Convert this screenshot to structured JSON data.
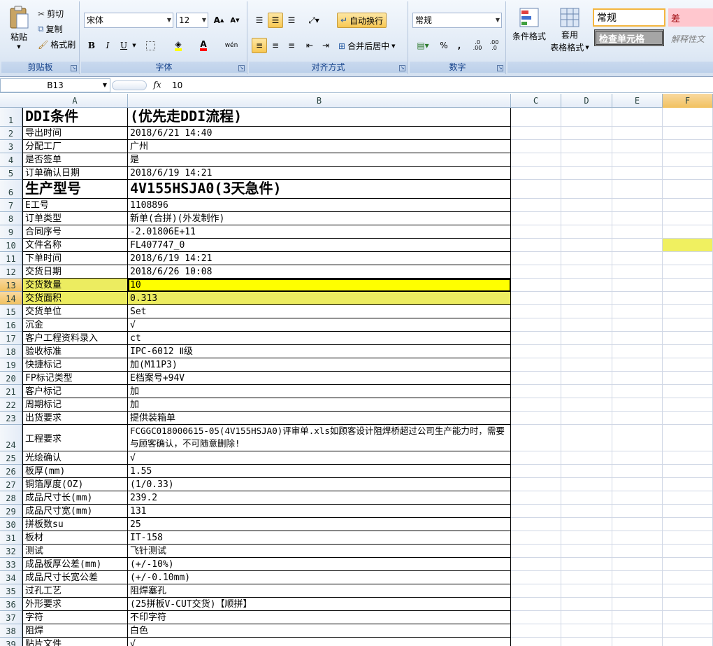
{
  "ribbon": {
    "clipboard": {
      "label": "剪贴板",
      "paste": "粘贴",
      "cut": "剪切",
      "copy": "复制",
      "format_painter": "格式刷"
    },
    "font": {
      "label": "字体",
      "font_name": "宋体",
      "font_size": "12",
      "bold": "B",
      "italic": "I",
      "underline": "U",
      "phonetic": "wén"
    },
    "alignment": {
      "label": "对齐方式",
      "wrap_text": "自动换行",
      "merge_center": "合并后居中"
    },
    "number": {
      "label": "数字",
      "format": "常规",
      "percent": "%",
      "comma": ",",
      "inc_decimal": ".0 .00",
      "dec_decimal": ".00 .0"
    },
    "styles": {
      "conditional": "条件格式",
      "table_format_1": "套用",
      "table_format_2": "表格格式",
      "style_normal": "常规",
      "style_bad": "差",
      "style_check": "检查单元格",
      "style_explain": "解释性文"
    }
  },
  "formula_bar": {
    "name_box": "B13",
    "fx": "fx",
    "content": "10"
  },
  "columns": [
    "A",
    "B",
    "C",
    "D",
    "E",
    "F"
  ],
  "selected_column": "F",
  "rows": [
    {
      "n": "1",
      "a": "DDI条件",
      "b": "(优先走DDI流程)",
      "style": "big"
    },
    {
      "n": "2",
      "a": "导出时间",
      "b": "2018/6/21 14:40"
    },
    {
      "n": "3",
      "a": "分配工厂",
      "b": "广州"
    },
    {
      "n": "4",
      "a": "是否签单",
      "b": "是"
    },
    {
      "n": "5",
      "a": "订单确认日期",
      "b": "2018/6/19 14:21"
    },
    {
      "n": "6",
      "a": "生产型号",
      "b": "4V155HSJA0(3天急件)",
      "style": "big"
    },
    {
      "n": "7",
      "a": "E工号",
      "b": "1108896"
    },
    {
      "n": "8",
      "a": "订单类型",
      "b": "新单(合拼)(外发制作)"
    },
    {
      "n": "9",
      "a": "合同序号",
      "b": "-2.01806E+11"
    },
    {
      "n": "10",
      "a": "文件名称",
      "b": "FL407747_0",
      "fsel": true
    },
    {
      "n": "11",
      "a": "下单时间",
      "b": "2018/6/19 14:21"
    },
    {
      "n": "12",
      "a": "交货日期",
      "b": "2018/6/26 10:08"
    },
    {
      "n": "13",
      "a": "交货数量",
      "b": "10",
      "style": "hl",
      "sel": true
    },
    {
      "n": "14",
      "a": "交货面积",
      "b": "0.313",
      "style": "hl2"
    },
    {
      "n": "15",
      "a": "交货单位",
      "b": "Set"
    },
    {
      "n": "16",
      "a": "沉金",
      "b": "√"
    },
    {
      "n": "17",
      "a": "客户工程资料录入",
      "b": "ct"
    },
    {
      "n": "18",
      "a": "验收标准",
      "b": "IPC-6012 Ⅱ级"
    },
    {
      "n": "19",
      "a": "快捷标记",
      "b": "加(M11P3)"
    },
    {
      "n": "20",
      "a": "FP标记类型",
      "b": "E档案号+94V"
    },
    {
      "n": "21",
      "a": "客户标记",
      "b": "加"
    },
    {
      "n": "22",
      "a": "周期标记",
      "b": "加"
    },
    {
      "n": "23",
      "a": "出货要求",
      "b": "提供装箱单"
    },
    {
      "n": "24",
      "a": "工程要求",
      "b": "FCGGC018000615-05(4V155HSJA0)评审单.xls如顾客设计阻焊桥超过公司生产能力时，需要与顾客确认，不可随意删除!",
      "style": "wrap"
    },
    {
      "n": "25",
      "a": "光绘确认",
      "b": "√"
    },
    {
      "n": "26",
      "a": "板厚(mm)",
      "b": "1.55"
    },
    {
      "n": "27",
      "a": "铜箔厚度(OZ)",
      "b": "(1/0.33)"
    },
    {
      "n": "28",
      "a": "成品尺寸长(mm)",
      "b": "239.2"
    },
    {
      "n": "29",
      "a": "成品尺寸宽(mm)",
      "b": "131"
    },
    {
      "n": "30",
      "a": "拼板数su",
      "b": "25"
    },
    {
      "n": "31",
      "a": "板材",
      "b": "IT-158"
    },
    {
      "n": "32",
      "a": "测试",
      "b": "飞针测试"
    },
    {
      "n": "33",
      "a": "成品板厚公差(mm)",
      "b": "(+/-10%)"
    },
    {
      "n": "34",
      "a": "成品尺寸长宽公差",
      "b": "(+/-0.10mm)"
    },
    {
      "n": "35",
      "a": "过孔工艺",
      "b": "阻焊塞孔"
    },
    {
      "n": "36",
      "a": "外形要求",
      "b": "(25拼板V-CUT交货)【顺拼】"
    },
    {
      "n": "37",
      "a": "字符",
      "b": "不印字符"
    },
    {
      "n": "38",
      "a": "阻焊",
      "b": "白色"
    },
    {
      "n": "39",
      "a": "贴片文件",
      "b": "√"
    }
  ]
}
